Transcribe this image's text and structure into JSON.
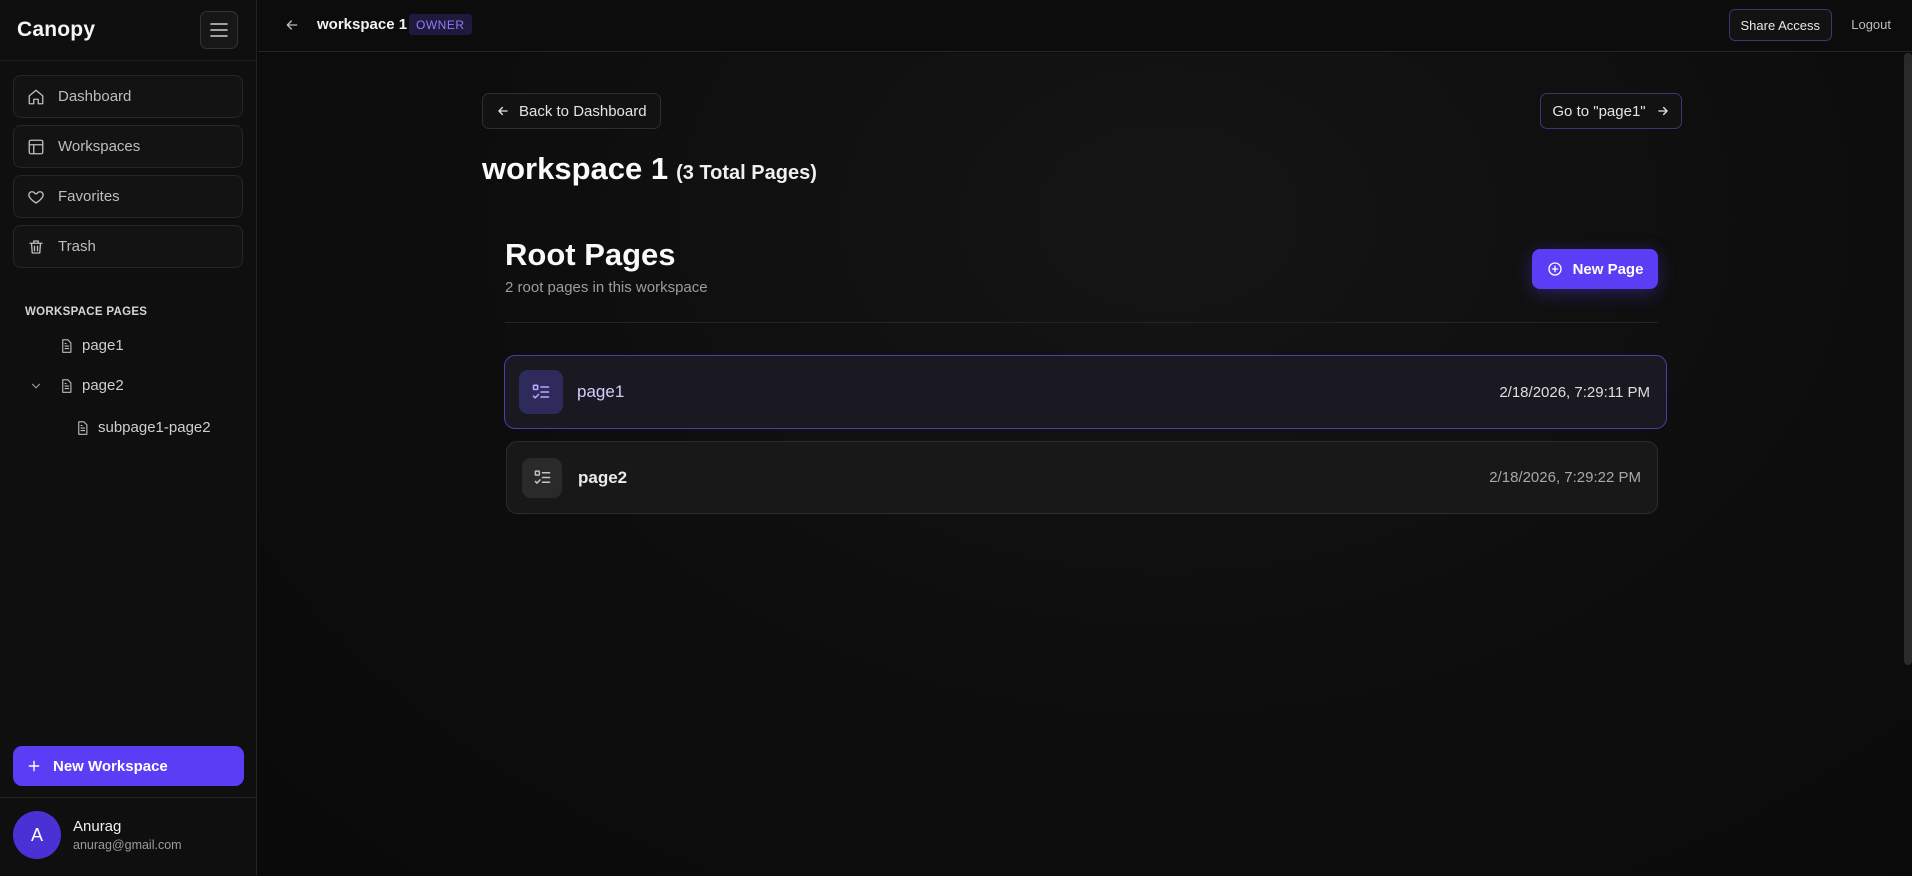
{
  "sidebar": {
    "brand": "Canopy",
    "nav": [
      {
        "label": "Dashboard",
        "icon": "home-icon"
      },
      {
        "label": "Workspaces",
        "icon": "layout-icon"
      },
      {
        "label": "Favorites",
        "icon": "heart-icon"
      },
      {
        "label": "Trash",
        "icon": "trash-icon"
      }
    ],
    "section_label": "WORKSPACE PAGES",
    "tree": [
      {
        "label": "page1"
      },
      {
        "label": "page2"
      },
      {
        "label": "subpage1-page2"
      }
    ],
    "new_workspace_label": "New Workspace",
    "user": {
      "initial": "A",
      "name": "Anurag",
      "email": "anurag@gmail.com"
    }
  },
  "topbar": {
    "title": "workspace 1",
    "badge": "OWNER",
    "share_label": "Share Access",
    "logout_label": "Logout"
  },
  "main": {
    "back_label": "Back to Dashboard",
    "goto_label": "Go to \"page1\"",
    "workspace_name": "workspace 1",
    "page_count_label": "(3 Total Pages)",
    "section_title": "Root Pages",
    "section_subtitle": "2 root pages in this workspace",
    "new_page_label": "New Page",
    "pages": [
      {
        "name": "page1",
        "date": "2/18/2026, 7:29:11 PM"
      },
      {
        "name": "page2",
        "date": "2/18/2026, 7:29:22 PM"
      }
    ]
  },
  "colors": {
    "accent": "#5b3df5",
    "background": "#0b0b0b"
  }
}
